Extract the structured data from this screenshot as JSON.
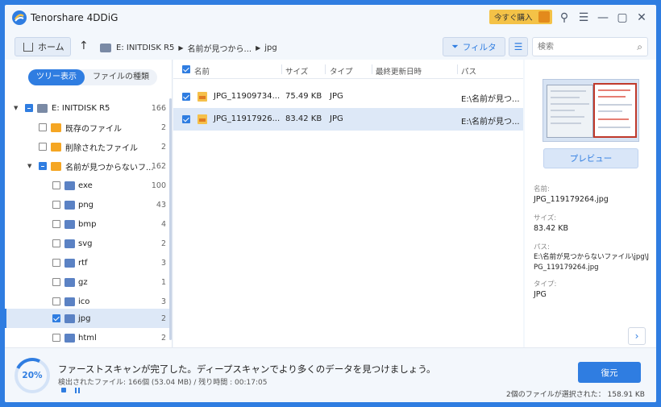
{
  "app": {
    "title": "Tenorshare 4DDiG",
    "buy_label": "今すぐ購入"
  },
  "nav": {
    "home_label": "ホーム",
    "path": [
      "E: INITDISK R5",
      "名前が見つから...",
      "jpg"
    ],
    "filter_label": "フィルタ",
    "search_placeholder": "検索"
  },
  "tree": {
    "tabs": [
      "ツリー表示",
      "ファイルの種類"
    ],
    "root": {
      "label": "E: INITDISK R5",
      "count": "166"
    },
    "items": [
      {
        "label": "既存のファイル",
        "count": "2"
      },
      {
        "label": "削除されたファイル",
        "count": "2"
      },
      {
        "label": "名前が見つからないフ...",
        "count": "162"
      },
      {
        "label": "exe",
        "count": "100"
      },
      {
        "label": "png",
        "count": "43"
      },
      {
        "label": "bmp",
        "count": "4"
      },
      {
        "label": "svg",
        "count": "2"
      },
      {
        "label": "rtf",
        "count": "3"
      },
      {
        "label": "gz",
        "count": "1"
      },
      {
        "label": "ico",
        "count": "3"
      },
      {
        "label": "jpg",
        "count": "2"
      },
      {
        "label": "html",
        "count": "2"
      }
    ]
  },
  "files": {
    "columns": [
      "名前",
      "サイズ",
      "タイプ",
      "最終更新日時",
      "パス"
    ],
    "rows": [
      {
        "name": "JPG_11909734...",
        "size": "75.49 KB",
        "type": "JPG",
        "modified": "",
        "path": "E:\\名前が見つ..."
      },
      {
        "name": "JPG_11917926...",
        "size": "83.42 KB",
        "type": "JPG",
        "modified": "",
        "path": "E:\\名前が見つ..."
      }
    ]
  },
  "preview": {
    "button_label": "プレビュー",
    "name_label": "名前:",
    "name_value": "JPG_119179264.jpg",
    "size_label": "サイズ:",
    "size_value": "83.42 KB",
    "path_label": "パス:",
    "path_value": "E:\\名前が見つからないファイル\\jpg\\JPG_119179264.jpg",
    "type_label": "タイプ:",
    "type_value": "JPG"
  },
  "footer": {
    "progress": "20%",
    "message": "ファーストスキャンが完了した。ディープスキャンでより多くのデータを見つけましょう。",
    "stats": "検出されたファイル: 166個 (53.04 MB) /  残り時間 : 00:17:05",
    "recover_label": "復元",
    "selection_info": "2個のファイルが選択された：  158.91 KB"
  },
  "colors": {
    "accent": "#2f7de1",
    "frame": "#2f7de1",
    "buy": "#f4c247"
  }
}
